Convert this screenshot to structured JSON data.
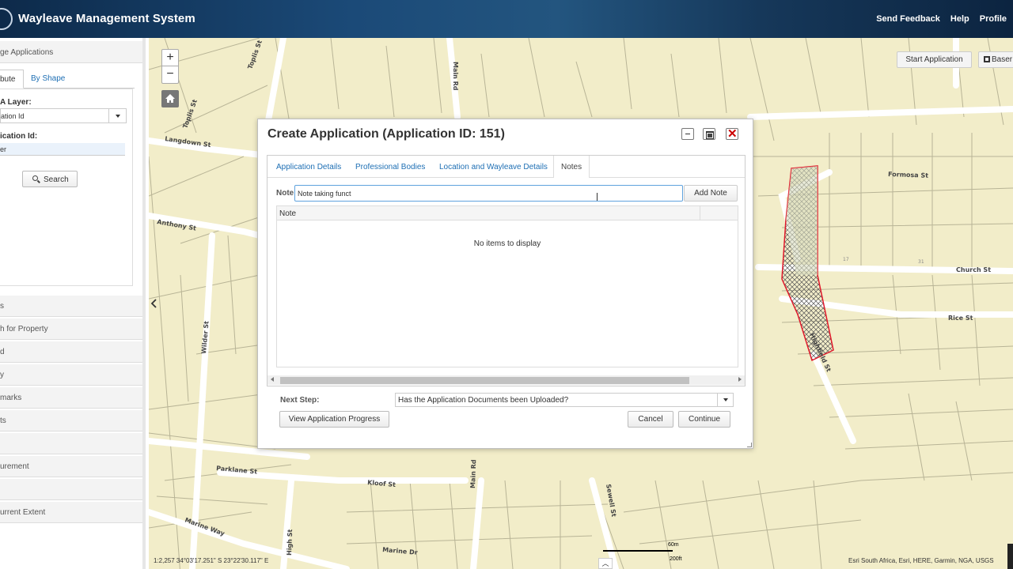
{
  "header": {
    "title": "Wayleave Management System",
    "links": [
      "Send Feedback",
      "Help",
      "Profile"
    ]
  },
  "sidebar": {
    "panel_title": "ge Applications",
    "tabs": [
      "bute",
      "By Shape"
    ],
    "layer_label": "A Layer:",
    "layer_value": "ation Id",
    "app_id_label": "ication Id:",
    "app_id_value": "er",
    "search_label": "Search",
    "items": [
      "s",
      "h for Property",
      "d",
      "y",
      "marks",
      "ts",
      "",
      "urement",
      "",
      "urrent Extent"
    ]
  },
  "map": {
    "start_application": "Start Application",
    "basemap": "Baser",
    "coordinates": "1:2,257   34°03'17.251\" S  23°22'30.117\" E",
    "attribution": "Esri South Africa, Esri, HERE, Garmin, NGA, USGS",
    "scale_top": "60m",
    "scale_bottom": "200ft",
    "street_labels": [
      "Toplis St",
      "Main Rd",
      "Toplis St",
      "Langdown St",
      "Anthony St",
      "Wilder St",
      "Parklane St",
      "Kloof St",
      "Main Rd",
      "High St",
      "Marine Way",
      "Marine Dr",
      "Sewell St",
      "Formosa St",
      "Church St",
      "Rice St",
      "Highfield St"
    ],
    "lot_numbers": [
      "17",
      "31"
    ]
  },
  "dialog": {
    "title": "Create Application (Application ID: 151)",
    "tabs": [
      "Application Details",
      "Professional Bodies",
      "Location and Wayleave Details",
      "Notes"
    ],
    "active_tab": "Notes",
    "note_label": "Note",
    "note_value": "Note taking funct",
    "add_note": "Add Note",
    "grid_header": "Note",
    "empty_text": "No items to display",
    "next_step_label": "Next Step:",
    "next_step_value": "Has the Application Documents been Uploaded?",
    "view_progress": "View Application Progress",
    "cancel": "Cancel",
    "continue": "Continue"
  }
}
